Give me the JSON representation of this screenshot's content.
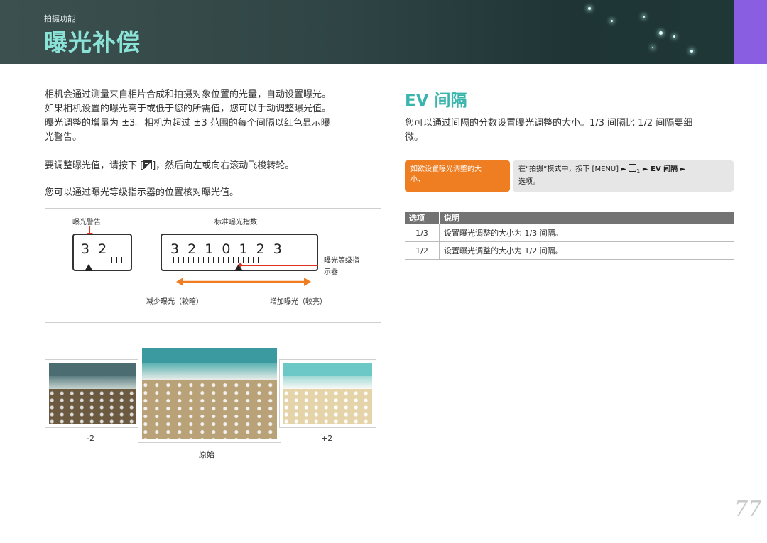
{
  "header": {
    "section": "拍摄功能",
    "title": "曝光补偿"
  },
  "intro": {
    "p1": [
      "相机会通过测量来自相片合成和拍摄对象位置的光量，自动设置曝光。",
      "如果相机设置的曝光高于或低于您的所需值，您可以手动调整曝光值。",
      "曝光调整的增量为 ±3。相机为超过 ±3 范围的每个间隔以红色显示曝",
      "光警告。"
    ],
    "p2": "要调整曝光值，请按下 [",
    "p2_end": "]，然后向左或向右滚动飞梭转轮。",
    "p3": "您可以通过曝光等级指示器的位置核对曝光值。"
  },
  "diagram": {
    "warn_label": "曝光警告",
    "std_label": "标准曝光指数",
    "meter_small": "3  2",
    "meter_big": "3 2 1 0 1 2 3",
    "minus": "–",
    "plus": "+",
    "indicator_label_1": "曝光等级指",
    "indicator_label_2": "示器",
    "decrease": "减少曝光（较暗）",
    "increase": "增加曝光（较亮）"
  },
  "photos": {
    "minus": "-2",
    "plus": "+2",
    "original": "原始"
  },
  "ev": {
    "title": "EV 间隔",
    "desc": [
      "您可以通过间隔的分数设置曝光调整的大小。1/3 间隔比 1/2 间隔要细",
      "微。"
    ],
    "callout_left": [
      "如欲设置曝光调整的大",
      "小，"
    ],
    "callout_right_1": "在“拍摄”模式中，按下 [MENU] ► ",
    "callout_right_icon": "1",
    "callout_right_2": " ► EV 间隔 ►",
    "callout_right_3": "选项。",
    "table": {
      "headers": [
        "选项",
        "说明"
      ],
      "rows": [
        [
          "1/3",
          "设置曝光调整的大小为 1/3 间隔。"
        ],
        [
          "1/2",
          "设置曝光调整的大小为 1/2 间隔。"
        ]
      ]
    }
  },
  "page_number": "77",
  "colors": {
    "accent_teal": "#3ab5ad",
    "header_title": "#8be3d8",
    "orange": "#ef7d21",
    "warning_red": "#e03020",
    "tab_purple": "#8a5ee0"
  }
}
